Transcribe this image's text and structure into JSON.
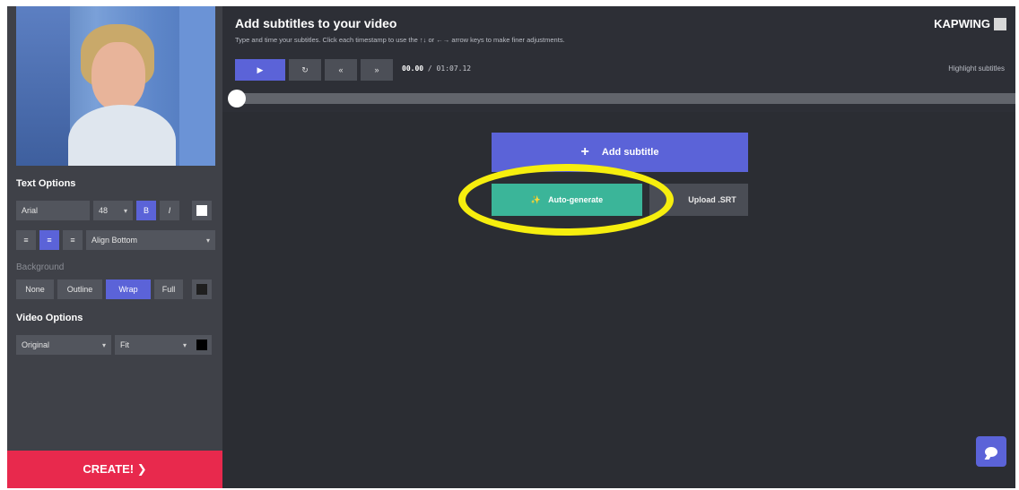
{
  "sidebar": {
    "text_options_title": "Text Options",
    "font": {
      "value": "Arial"
    },
    "font_size": {
      "value": "48"
    },
    "bold_label": "B",
    "italic_label": "I",
    "text_color": "#ffffff",
    "align_left_label": "≡",
    "align_center_label": "≡",
    "align_right_label": "≡",
    "vertical_align": {
      "value": "Align Bottom"
    },
    "background_title": "Background",
    "background_options": [
      "None",
      "Outline",
      "Wrap",
      "Full"
    ],
    "background_selected": "Wrap",
    "background_color": "#1f1f1f",
    "video_options_title": "Video Options",
    "size": {
      "value": "Original"
    },
    "fit": {
      "value": "Fit"
    },
    "video_bg_color": "#000000",
    "create_label": "CREATE! ❯"
  },
  "main": {
    "title": "Add subtitles to your video",
    "hint": "Type and time your subtitles. Click each timestamp to use the ↑↓ or ←→ arrow keys to make finer adjustments.",
    "logo_text": "KAPWING",
    "player": {
      "play_icon": "▶",
      "replay_icon": "↻",
      "back_label": "«",
      "forward_label": "»",
      "current_time": "00.00",
      "duration": "/ 01:07.12"
    },
    "highlight_label": "Highlight subtitles",
    "progress": 0.0,
    "add_subtitle_label": "Add subtitle",
    "auto_generate_label": "Auto-generate",
    "upload_srt_label": "Upload .SRT"
  },
  "colors": {
    "accent": "#5b63d8",
    "create": "#e8294d",
    "auto": "#3bb599",
    "annotation": "#f6ee0e"
  }
}
